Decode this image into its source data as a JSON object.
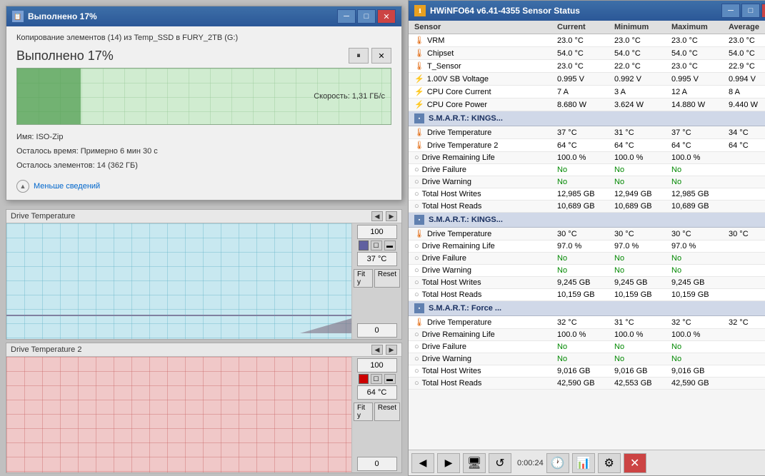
{
  "copyDialog": {
    "title": "Выполнено 17%",
    "pathText": "Копирование элементов (14) из Temp_SSD в FURY_2TB (G:)",
    "progressTitle": "Выполнено 17%",
    "speed": "Скорость: 1,31 ГБ/с",
    "name": "Имя: ISO-Zip",
    "timeLeft": "Осталось время:  Примерно 6 мин 30 с",
    "itemsLeft": "Осталось элементов: 14 (362 ГБ)",
    "detailsLabel": "Меньше сведений",
    "pauseLabel": "⏸",
    "closeLabel": "✕",
    "progressPercent": 17
  },
  "charts": [
    {
      "title": "Drive Temperature",
      "value": "37 °C",
      "min": "0",
      "max": "100",
      "colorClass": "blue-chart",
      "swatchColor": "#6060a0"
    },
    {
      "title": "Drive Temperature 2",
      "value": "64 °C",
      "min": "0",
      "max": "100",
      "colorClass": "red-chart",
      "swatchColor": "#cc0000"
    }
  ],
  "hwinfo": {
    "title": "HWiNFO64 v6.41-4355 Sensor Status",
    "columns": [
      "Sensor",
      "Current",
      "Minimum",
      "Maximum",
      "Average"
    ],
    "scrollbarVisible": true
  },
  "sensors": {
    "mainSection": {
      "rows": [
        {
          "name": "VRM",
          "current": "23.0 °C",
          "minimum": "23.0 °C",
          "maximum": "23.0 °C",
          "average": "23.0 °C",
          "icon": "flame"
        },
        {
          "name": "Chipset",
          "current": "54.0 °C",
          "minimum": "54.0 °C",
          "maximum": "54.0 °C",
          "average": "54.0 °C",
          "icon": "flame"
        },
        {
          "name": "T_Sensor",
          "current": "23.0 °C",
          "minimum": "22.0 °C",
          "maximum": "23.0 °C",
          "average": "22.9 °C",
          "icon": "flame"
        },
        {
          "name": "1.00V SB Voltage",
          "current": "0.995 V",
          "minimum": "0.992 V",
          "maximum": "0.995 V",
          "average": "0.994 V",
          "icon": "bolt"
        },
        {
          "name": "CPU Core Current",
          "current": "7 A",
          "minimum": "3 A",
          "maximum": "12 A",
          "average": "8 A",
          "icon": "bolt"
        },
        {
          "name": "CPU Core Power",
          "current": "8.680 W",
          "minimum": "3.624 W",
          "maximum": "14.880 W",
          "average": "9.440 W",
          "icon": "bolt"
        }
      ]
    },
    "sections": [
      {
        "header": "S.M.A.R.T.: KINGS...",
        "rows": [
          {
            "name": "Drive Temperature",
            "current": "37 °C",
            "minimum": "31 °C",
            "maximum": "37 °C",
            "average": "34 °C",
            "icon": "flame"
          },
          {
            "name": "Drive Temperature 2",
            "current": "64 °C",
            "minimum": "64 °C",
            "maximum": "64 °C",
            "average": "64 °C",
            "icon": "flame"
          },
          {
            "name": "Drive Remaining Life",
            "current": "100.0 %",
            "minimum": "100.0 %",
            "maximum": "100.0 %",
            "average": "",
            "icon": "circle"
          },
          {
            "name": "Drive Failure",
            "current": "No",
            "minimum": "No",
            "maximum": "No",
            "average": "",
            "icon": "circle"
          },
          {
            "name": "Drive Warning",
            "current": "No",
            "minimum": "No",
            "maximum": "No",
            "average": "",
            "icon": "circle"
          },
          {
            "name": "Total Host Writes",
            "current": "12,985 GB",
            "minimum": "12,949 GB",
            "maximum": "12,985 GB",
            "average": "",
            "icon": "circle"
          },
          {
            "name": "Total Host Reads",
            "current": "10,689 GB",
            "minimum": "10,689 GB",
            "maximum": "10,689 GB",
            "average": "",
            "icon": "circle"
          }
        ]
      },
      {
        "header": "S.M.A.R.T.: KINGS...",
        "rows": [
          {
            "name": "Drive Temperature",
            "current": "30 °C",
            "minimum": "30 °C",
            "maximum": "30 °C",
            "average": "30 °C",
            "icon": "flame"
          },
          {
            "name": "Drive Remaining Life",
            "current": "97.0 %",
            "minimum": "97.0 %",
            "maximum": "97.0 %",
            "average": "",
            "icon": "circle"
          },
          {
            "name": "Drive Failure",
            "current": "No",
            "minimum": "No",
            "maximum": "No",
            "average": "",
            "icon": "circle"
          },
          {
            "name": "Drive Warning",
            "current": "No",
            "minimum": "No",
            "maximum": "No",
            "average": "",
            "icon": "circle"
          },
          {
            "name": "Total Host Writes",
            "current": "9,245 GB",
            "minimum": "9,245 GB",
            "maximum": "9,245 GB",
            "average": "",
            "icon": "circle"
          },
          {
            "name": "Total Host Reads",
            "current": "10,159 GB",
            "minimum": "10,159 GB",
            "maximum": "10,159 GB",
            "average": "",
            "icon": "circle"
          }
        ]
      },
      {
        "header": "S.M.A.R.T.: Force ...",
        "rows": [
          {
            "name": "Drive Temperature",
            "current": "32 °C",
            "minimum": "31 °C",
            "maximum": "32 °C",
            "average": "32 °C",
            "icon": "flame"
          },
          {
            "name": "Drive Remaining Life",
            "current": "100.0 %",
            "minimum": "100.0 %",
            "maximum": "100.0 %",
            "average": "",
            "icon": "circle"
          },
          {
            "name": "Drive Failure",
            "current": "No",
            "minimum": "No",
            "maximum": "No",
            "average": "",
            "icon": "circle"
          },
          {
            "name": "Drive Warning",
            "current": "No",
            "minimum": "No",
            "maximum": "No",
            "average": "",
            "icon": "circle"
          },
          {
            "name": "Total Host Writes",
            "current": "9,016 GB",
            "minimum": "9,016 GB",
            "maximum": "9,016 GB",
            "average": "",
            "icon": "circle"
          },
          {
            "name": "Total Host Reads",
            "current": "42,590 GB",
            "minimum": "42,553 GB",
            "maximum": "42,590 GB",
            "average": "",
            "icon": "circle"
          }
        ]
      }
    ]
  },
  "statusbar": {
    "time": "0:00:24",
    "navPrevLabel": "◀",
    "navNextLabel": "▶",
    "navSkipLabel": "▶▶"
  }
}
